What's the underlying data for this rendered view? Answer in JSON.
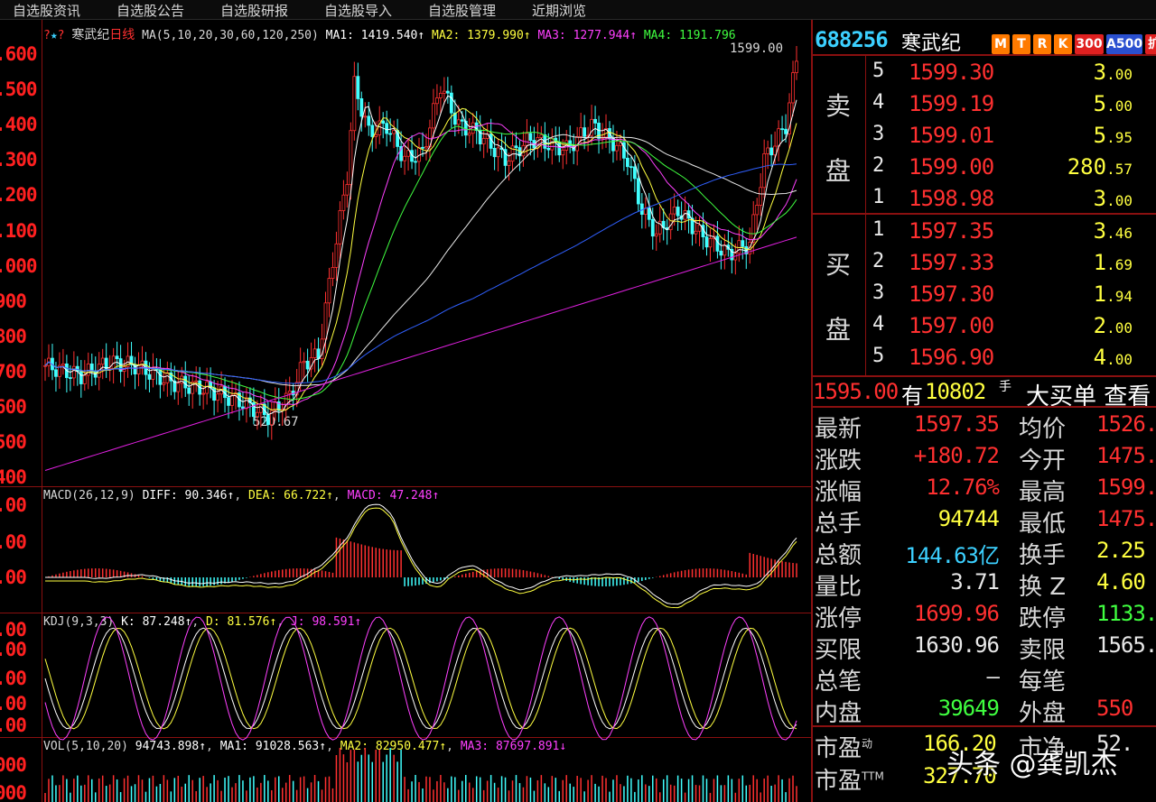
{
  "menu": [
    "自选股资讯",
    "自选股公告",
    "自选股研报",
    "自选股导入",
    "自选股管理",
    "近期浏览"
  ],
  "main_header": {
    "name": "寒武纪",
    "period": "日线",
    "ma_label": "MA(5,10,20,30,60,120,250)",
    "ma1": "MA1: 1419.540↑",
    "ma2": "MA2: 1379.990↑",
    "ma3": "MA3: 1277.944↑",
    "ma4": "MA4: 1191.796"
  },
  "price_axis": [
    "1600",
    "1500",
    "1400",
    "1300",
    "1200",
    "1100",
    "1000",
    "900",
    "800",
    "700",
    "600",
    "500",
    "400"
  ],
  "price_axis_display": [
    ".600",
    ".500",
    ".400",
    ".300",
    ".200",
    ".100",
    ".000",
    "900",
    "800",
    "700",
    "600",
    "500",
    "400"
  ],
  "annotations": {
    "high": "1599.00",
    "low": "520.67"
  },
  "macd_header": {
    "label": "MACD(26,12,9)",
    "diff": "DIFF: 90.346↑",
    "dea": "DEA: 66.722↑",
    "macd": "MACD: 47.248↑"
  },
  "macd_axis": [
    ".00",
    ".00",
    ".00"
  ],
  "kdj_header": {
    "label": "KDJ(9,3,3)",
    "k": "K: 87.248↑",
    "d": "D: 81.576↑",
    "j": "J: 98.591↑"
  },
  "kdj_axis": [
    ".00",
    ".00",
    ".00",
    ".00",
    ".00"
  ],
  "vol_header": {
    "label": "VOL(5,10,20)",
    "vol": "94743.898↑",
    "ma1": "MA1: 91028.563↑",
    "ma2": "MA2: 82950.477↑",
    "ma3": "MA3: 87697.891↓"
  },
  "vol_axis": [
    "000",
    "000"
  ],
  "quote": {
    "code": "688256",
    "name": "寒武纪",
    "badges": [
      {
        "text": "M",
        "color": "#ff7a00"
      },
      {
        "text": "T",
        "color": "#ff7a00"
      },
      {
        "text": "R",
        "color": "#ff7a00"
      },
      {
        "text": "K",
        "color": "#ff7a00"
      },
      {
        "text": "300",
        "color": "#e02020"
      },
      {
        "text": "A500",
        "color": "#2a50d0"
      },
      {
        "text": "扩",
        "color": "#e02020"
      }
    ]
  },
  "orderbook": {
    "sell_label_1": "卖",
    "sell_label_2": "盘",
    "buy_label_1": "买",
    "buy_label_2": "盘",
    "asks": [
      {
        "idx": "5",
        "price": "1599.30",
        "vol": "3",
        "dec": ".00"
      },
      {
        "idx": "4",
        "price": "1599.19",
        "vol": "5",
        "dec": ".00"
      },
      {
        "idx": "3",
        "price": "1599.01",
        "vol": "5",
        "dec": ".95"
      },
      {
        "idx": "2",
        "price": "1599.00",
        "vol": "280",
        "dec": ".57"
      },
      {
        "idx": "1",
        "price": "1598.98",
        "vol": "3",
        "dec": ".00"
      }
    ],
    "bids": [
      {
        "idx": "1",
        "price": "1597.35",
        "vol": "3",
        "dec": ".46"
      },
      {
        "idx": "2",
        "price": "1597.33",
        "vol": "1",
        "dec": ".69"
      },
      {
        "idx": "3",
        "price": "1597.30",
        "vol": "1",
        "dec": ".94"
      },
      {
        "idx": "4",
        "price": "1597.00",
        "vol": "2",
        "dec": ".00"
      },
      {
        "idx": "5",
        "price": "1596.90",
        "vol": "4",
        "dec": ".00"
      }
    ]
  },
  "bigbuy": {
    "price": "1595.00",
    "has": "有",
    "qty": "10802",
    "unit": "手",
    "label": "大买单 查看"
  },
  "stats": [
    {
      "l": "最新",
      "v": "1597.35",
      "vc": "#ff3030",
      "r": "均价",
      "v2": "1526.",
      "v2c": "#ff3030"
    },
    {
      "l": "涨跌",
      "v": "+180.72",
      "vc": "#ff3030",
      "r": "今开",
      "v2": "1475.",
      "v2c": "#ff3030"
    },
    {
      "l": "涨幅",
      "v": "12.76%",
      "vc": "#ff3030",
      "r": "最高",
      "v2": "1599.",
      "v2c": "#ff3030"
    },
    {
      "l": "总手",
      "v": "94744",
      "vc": "#ffff40",
      "r": "最低",
      "v2": "1475.",
      "v2c": "#ff3030"
    },
    {
      "l": "总额",
      "v": "144.63亿",
      "vc": "#3cd0ff",
      "r": "换手",
      "v2": "2.25",
      "v2c": "#ffff40"
    },
    {
      "l": "量比",
      "v": "3.71",
      "vc": "#e8e8e8",
      "r": "换 Z",
      "v2": "4.60",
      "v2c": "#ffff40"
    },
    {
      "l": "涨停",
      "v": "1699.96",
      "vc": "#ff3030",
      "r": "跌停",
      "v2": "1133.",
      "v2c": "#40ff40"
    },
    {
      "l": "买限",
      "v": "1630.96",
      "vc": "#e8e8e8",
      "r": "卖限",
      "v2": "1565.",
      "v2c": "#e8e8e8"
    },
    {
      "l": "总笔",
      "v": "–",
      "vc": "#e8e8e8",
      "r": "每笔",
      "v2": "",
      "v2c": "#e8e8e8"
    },
    {
      "l": "内盘",
      "v": "39649",
      "vc": "#40ff40",
      "r": "外盘",
      "v2": "550",
      "v2c": "#ff3030"
    }
  ],
  "valuation": [
    {
      "l": "市盈",
      "sup": "动",
      "v": "166.20",
      "r": "市净",
      "v2": "52."
    },
    {
      "l": "市盈",
      "sup": "TTM",
      "v": "327.70",
      "r": "",
      "v2": ""
    }
  ],
  "watermark": "头条 @龚凯杰",
  "colors": {
    "up": "#ff3030",
    "down": "#40ffff",
    "grid": "#8a1010",
    "ma_white": "#ffffff",
    "ma_yellow": "#ffff40",
    "ma_magenta": "#ff40ff",
    "ma_green": "#40ff40",
    "ma_blue": "#3060ff"
  }
}
